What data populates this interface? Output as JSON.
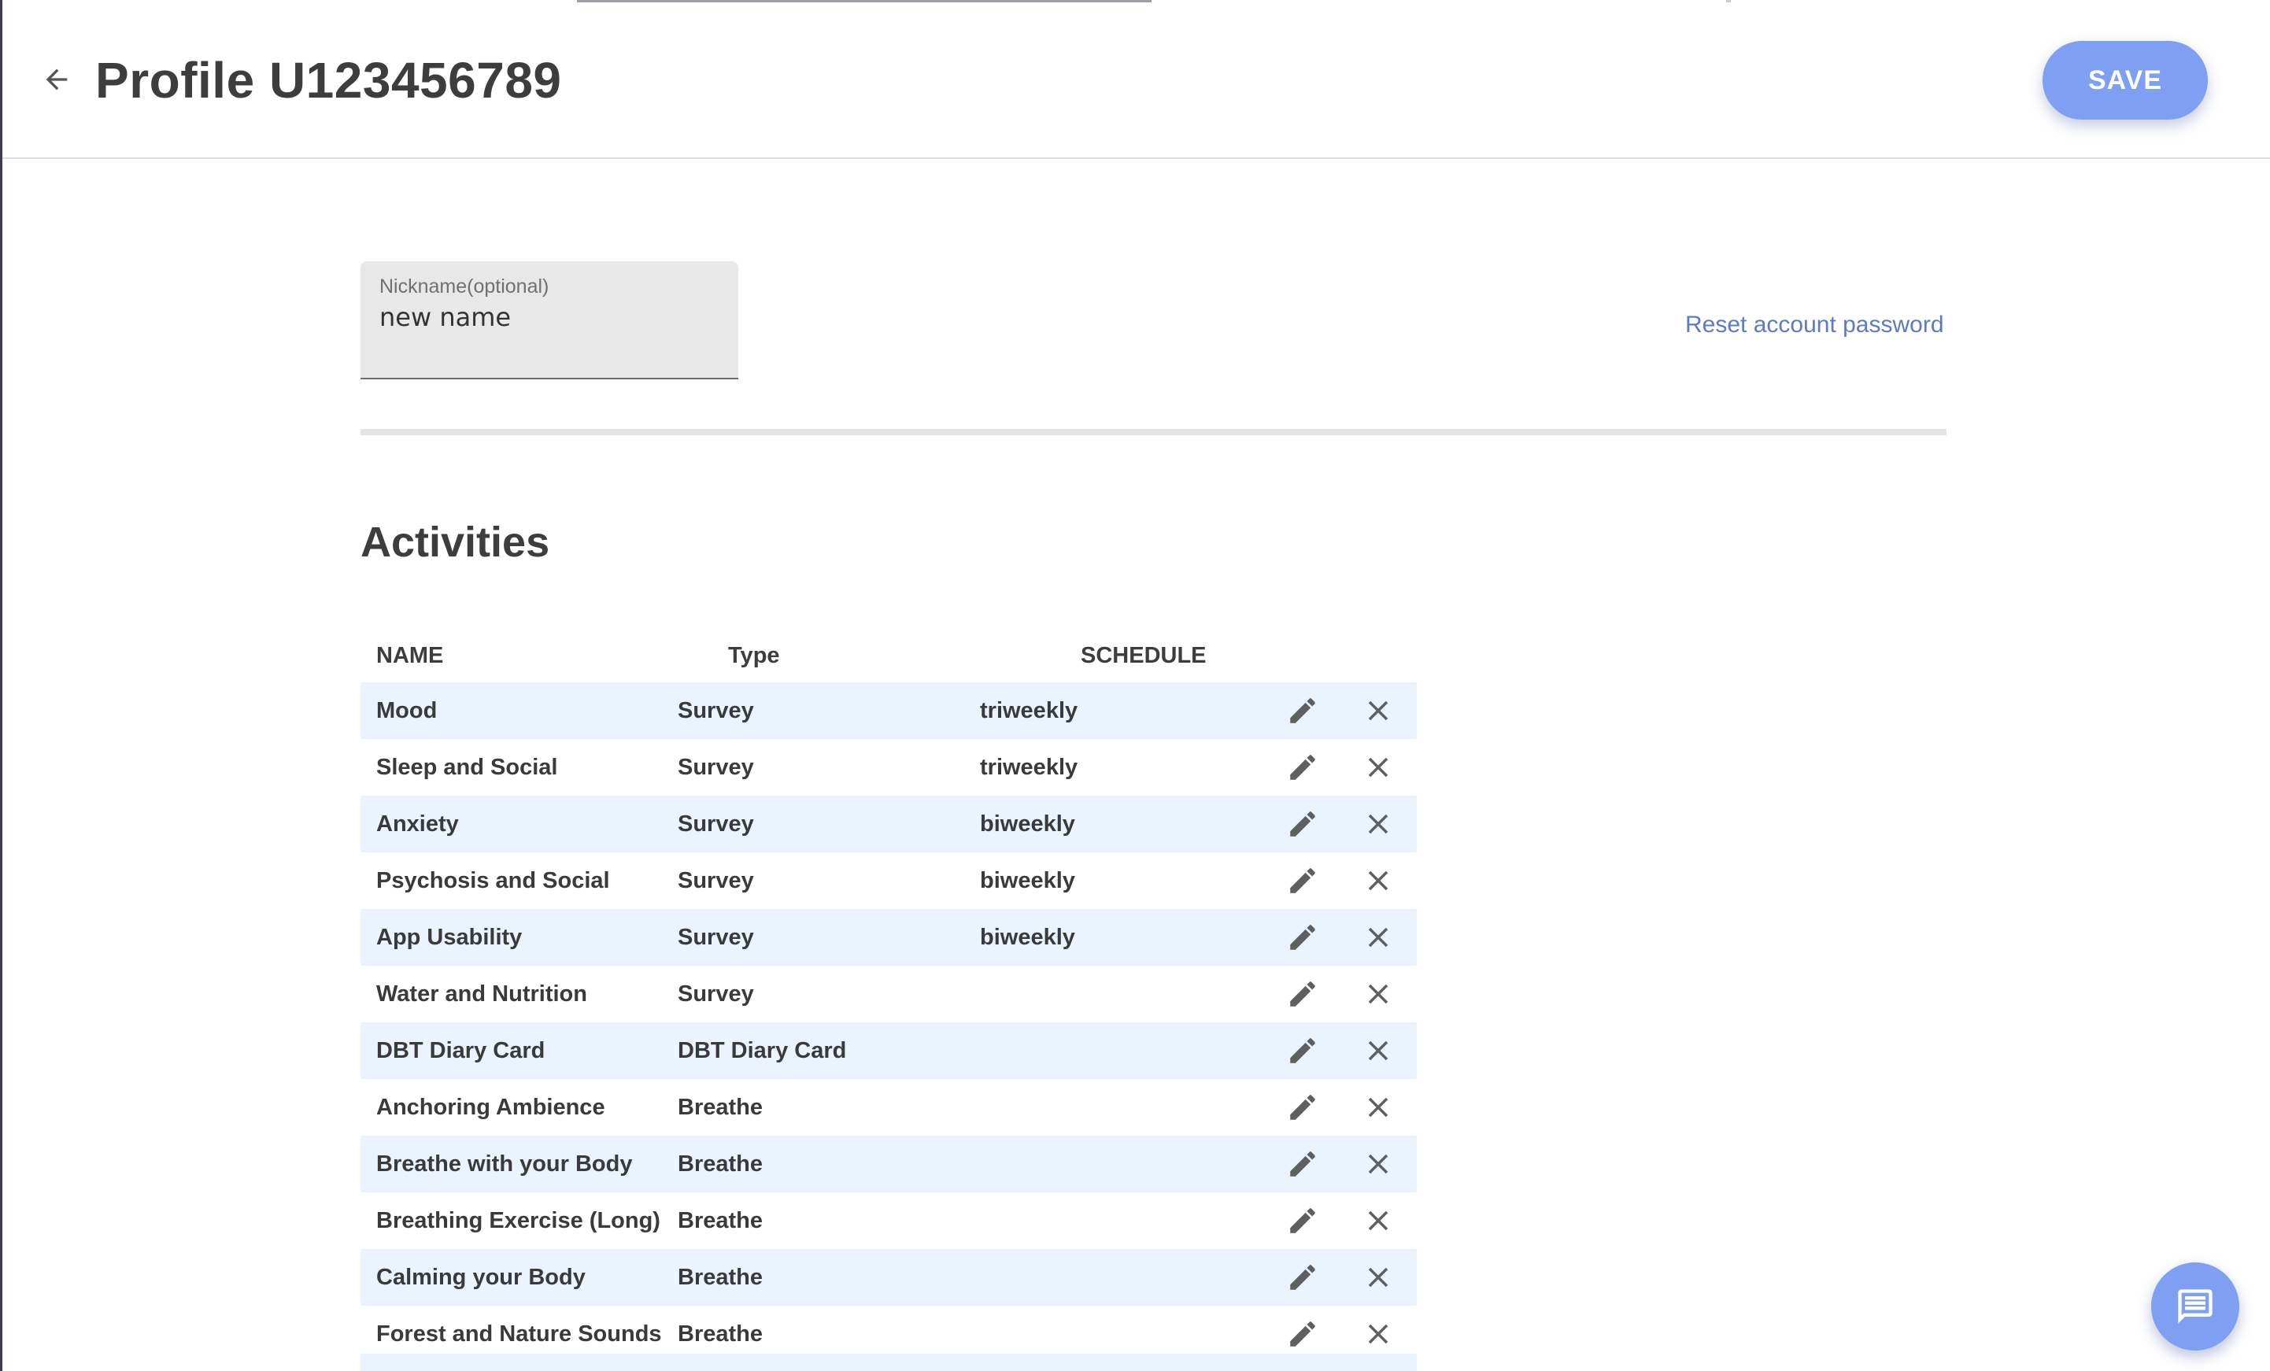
{
  "header": {
    "title": "Profile U123456789",
    "back_icon": "arrow-left-icon",
    "save_label": "SAVE"
  },
  "profile": {
    "nickname_label": "Nickname(optional)",
    "nickname_value": "new name",
    "reset_password_label": "Reset account password"
  },
  "activities": {
    "title": "Activities",
    "columns": {
      "name": "NAME",
      "type": "Type",
      "schedule": "SCHEDULE"
    },
    "rows": [
      {
        "name": "Mood",
        "type": "Survey",
        "schedule": "triweekly"
      },
      {
        "name": "Sleep and Social",
        "type": "Survey",
        "schedule": "triweekly"
      },
      {
        "name": "Anxiety",
        "type": "Survey",
        "schedule": "biweekly"
      },
      {
        "name": "Psychosis and Social",
        "type": "Survey",
        "schedule": "biweekly"
      },
      {
        "name": "App Usability",
        "type": "Survey",
        "schedule": "biweekly"
      },
      {
        "name": "Water and Nutrition",
        "type": "Survey",
        "schedule": ""
      },
      {
        "name": "DBT Diary Card",
        "type": "DBT Diary Card",
        "schedule": ""
      },
      {
        "name": "Anchoring Ambience",
        "type": "Breathe",
        "schedule": ""
      },
      {
        "name": "Breathe with your Body",
        "type": "Breathe",
        "schedule": ""
      },
      {
        "name": "Breathing Exercise (Long)",
        "type": "Breathe",
        "schedule": ""
      },
      {
        "name": "Calming your Body",
        "type": "Breathe",
        "schedule": ""
      },
      {
        "name": "Forest and Nature Sounds",
        "type": "Breathe",
        "schedule": ""
      }
    ],
    "row_icons": {
      "edit": "pencil-icon",
      "delete": "close-icon"
    }
  },
  "chat": {
    "icon": "chat-icon"
  },
  "colors": {
    "accent": "#7e9ff2",
    "link": "#5b7bc7",
    "row_stripe": "#ebf3fe",
    "field_bg": "#e8e8e8"
  }
}
